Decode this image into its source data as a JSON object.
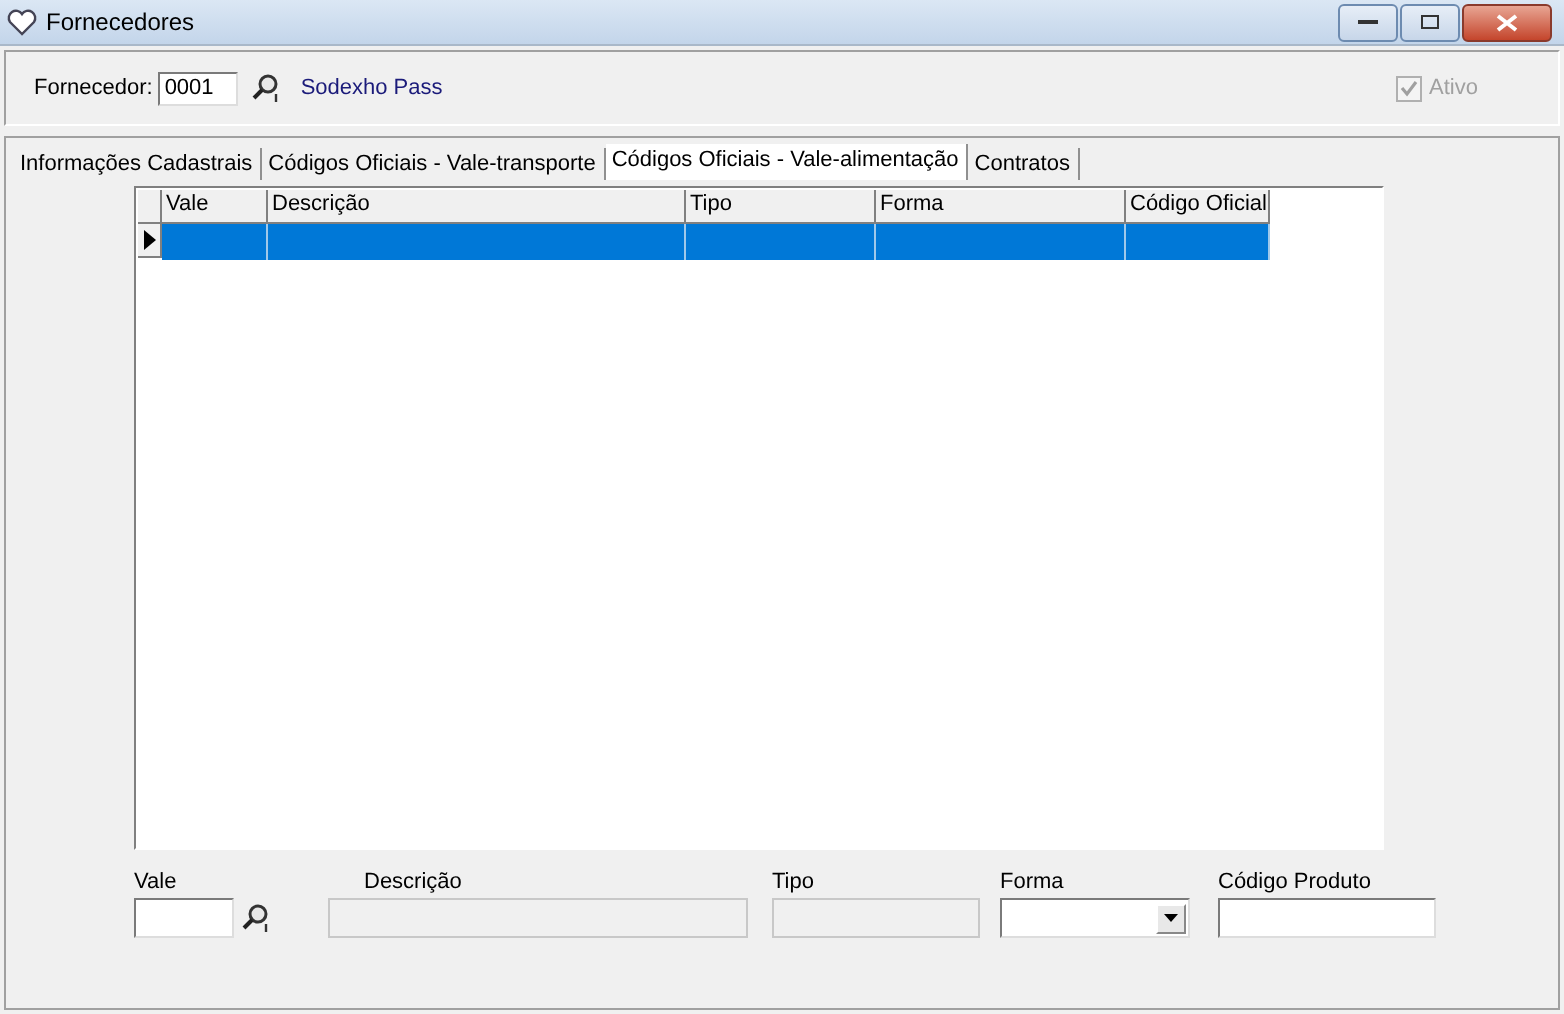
{
  "window": {
    "title": "Fornecedores"
  },
  "header": {
    "label": "Fornecedor:",
    "value": "0001",
    "name": "Sodexho Pass",
    "active": {
      "label": "Ativo",
      "checked": true,
      "disabled": true
    }
  },
  "tabs": [
    {
      "label": "Informações Cadastrais",
      "selected": false
    },
    {
      "label": "Códigos Oficiais - Vale-transporte",
      "selected": false
    },
    {
      "label": "Códigos Oficiais - Vale-alimentação",
      "selected": true
    },
    {
      "label": "Contratos",
      "selected": false
    }
  ],
  "grid": {
    "columns": [
      "Vale",
      "Descrição",
      "Tipo",
      "Forma",
      "Código Oficial"
    ],
    "rows": [
      {
        "selected": true
      }
    ]
  },
  "fields": [
    {
      "kind": "lookup",
      "label": "Vale",
      "disabled": false
    },
    {
      "kind": "text",
      "label": "Descrição",
      "disabled": true
    },
    {
      "kind": "text",
      "label": "Tipo",
      "disabled": true
    },
    {
      "kind": "dropdown",
      "label": "Forma",
      "disabled": false
    },
    {
      "kind": "text",
      "label": "Código Produto",
      "disabled": false
    }
  ]
}
